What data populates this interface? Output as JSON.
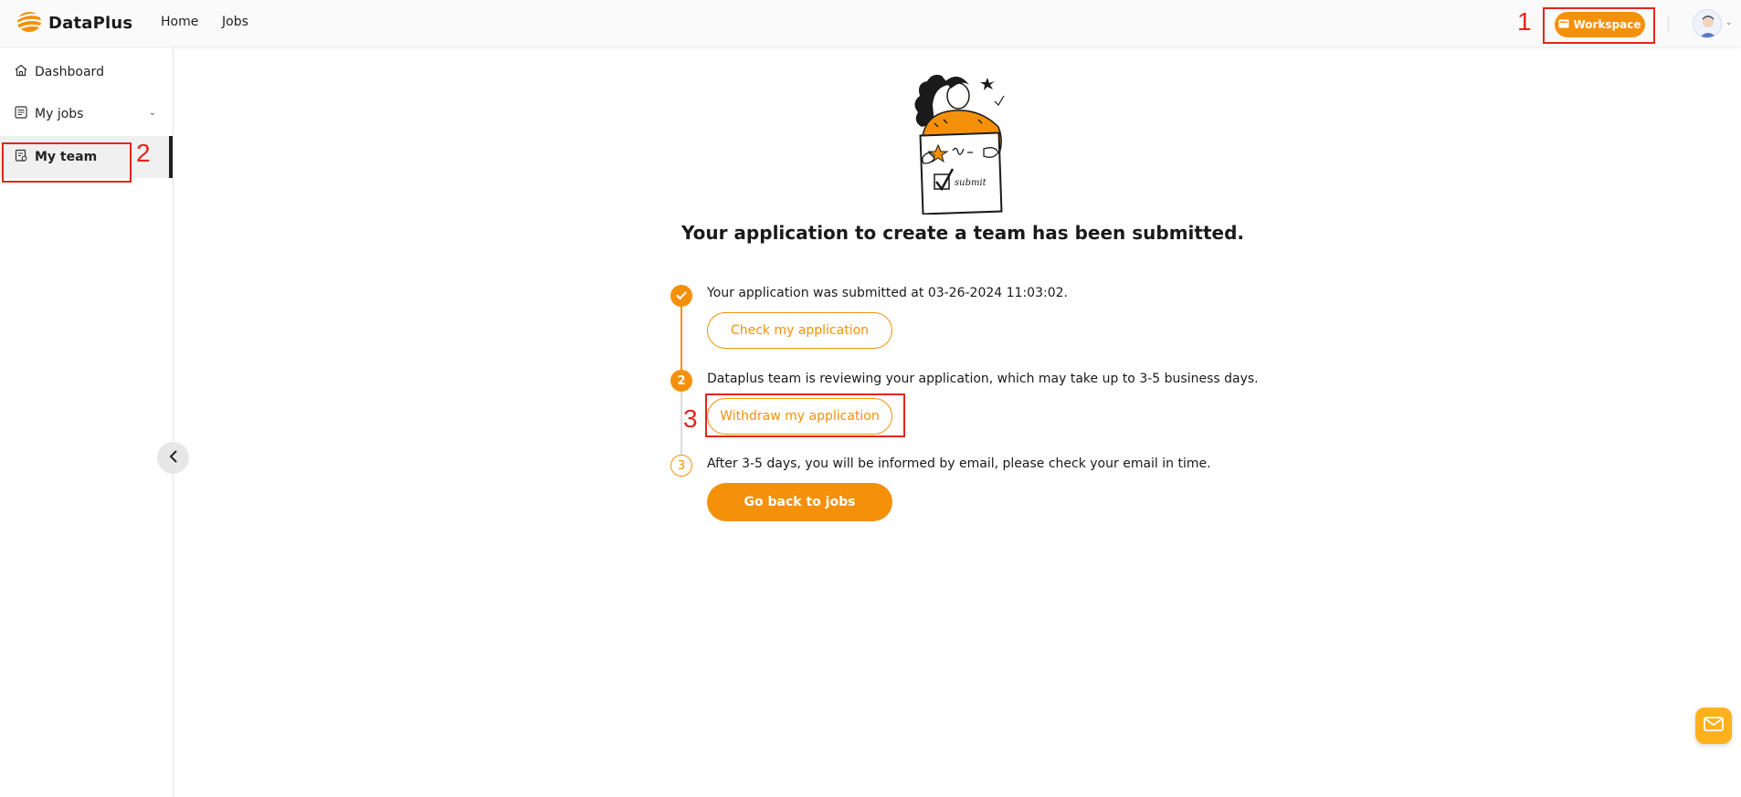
{
  "header": {
    "logo_text": "DataPlus",
    "nav": [
      {
        "label": "Home"
      },
      {
        "label": "Jobs"
      }
    ],
    "workspace_label": "Workspace",
    "icons": [
      "logo-icon",
      "workspace-icon",
      "avatar",
      "chevron-down-icon"
    ]
  },
  "sidebar": {
    "items": [
      {
        "label": "Dashboard",
        "icon": "home-icon"
      },
      {
        "label": "My jobs",
        "icon": "jobs-icon",
        "expandable": true
      },
      {
        "label": "My team",
        "icon": "team-icon",
        "active": true
      }
    ],
    "collapse_icon": "chevron-left-icon"
  },
  "main": {
    "title": "Your application to create a team has been submitted.",
    "steps": [
      {
        "marker": "",
        "status": "done",
        "text": "Your application was submitted at 03-26-2024 11:03:02.",
        "button": "Check my application"
      },
      {
        "marker": "2",
        "status": "current",
        "text": "Dataplus team is reviewing your application, which may take up to 3-5 business days.",
        "button": "Withdraw my application"
      },
      {
        "marker": "3",
        "status": "waiting",
        "text": "After 3-5 days, you will be informed by email, please check your email in time.",
        "button": "Go back to jobs"
      }
    ],
    "illustration_text": "submit"
  },
  "annotations": [
    {
      "number": "1",
      "target": "Workspace"
    },
    {
      "number": "2",
      "target": "My team"
    },
    {
      "number": "3",
      "target": "Withdraw my application"
    }
  ],
  "floating": {
    "icon": "mail-icon"
  },
  "colors": {
    "accent": "#f5900b",
    "annotation": "#e3261b",
    "mail": "#ffb11c"
  }
}
